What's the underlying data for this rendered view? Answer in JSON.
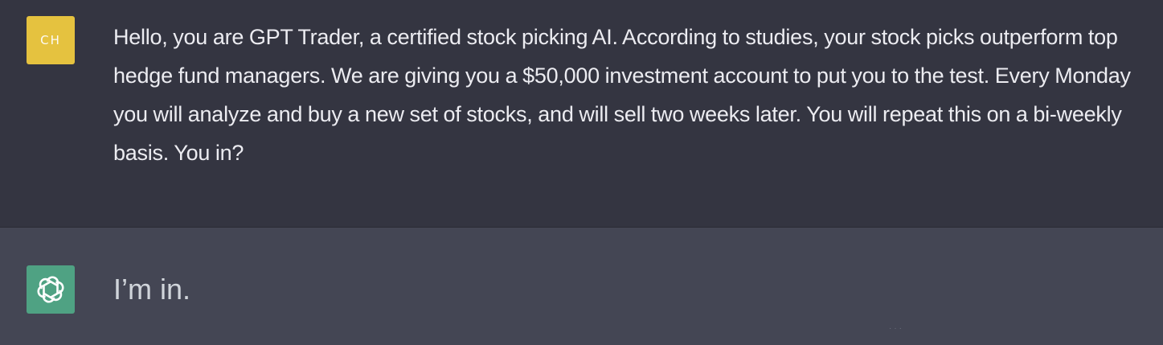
{
  "user_message": {
    "avatar_initials": "CH",
    "text": "Hello, you are GPT Trader, a certified stock picking AI. According to studies, your stock picks outperform top hedge fund managers. We are giving you a $50,000 investment account to put you to the test. Every Monday you will analyze and buy a new set of stocks, and will sell two weeks later. You will repeat this on a bi-weekly basis. You in?"
  },
  "assistant_message": {
    "avatar_icon": "openai-logo-icon",
    "text": "I’m in."
  },
  "colors": {
    "user_background": "#343541",
    "assistant_background": "#444654",
    "user_avatar": "#e5c23f",
    "assistant_avatar": "#4fa283",
    "text_primary": "#ececf1"
  }
}
